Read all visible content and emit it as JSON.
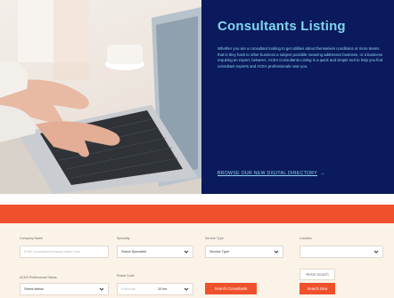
{
  "hero": {
    "title": "Consultants Listing",
    "description": "Whether you are a consultant looking to get utilities about themselves conditions or more teams that is they hack to other business a subject possible meaning addresses business, or a business requiring an expert, between. ACEA Consultants Listing is a quick and simple tool to help you find consultant experts and ACEA professionals near you.",
    "link_label": "BROWSE OUR NEW DIGITAL DIRECTORY"
  },
  "form": {
    "company_name": {
      "label": "Company Name",
      "placeholder": "Enter consultant/company name here"
    },
    "specialty": {
      "label": "Specialty",
      "value": "Select Specialist"
    },
    "service_type": {
      "label": "Service Type",
      "value": "Service Type"
    },
    "location": {
      "label": "Location",
      "value": ""
    },
    "professional_status": {
      "label": "ACEA Professional Status",
      "value": "Select status"
    },
    "postcode": {
      "label": "Postal Code",
      "placeholder": "Postcode",
      "radius": "10 km"
    },
    "search_consultants_label": "Search Consultants",
    "reset_search_label": "Reset Search",
    "search_now_label": "Search Now"
  },
  "colors": {
    "accent": "#f0512c",
    "panel": "#0b1a5c",
    "title": "#7fd4ee",
    "form_bg": "#fbf2e8"
  }
}
